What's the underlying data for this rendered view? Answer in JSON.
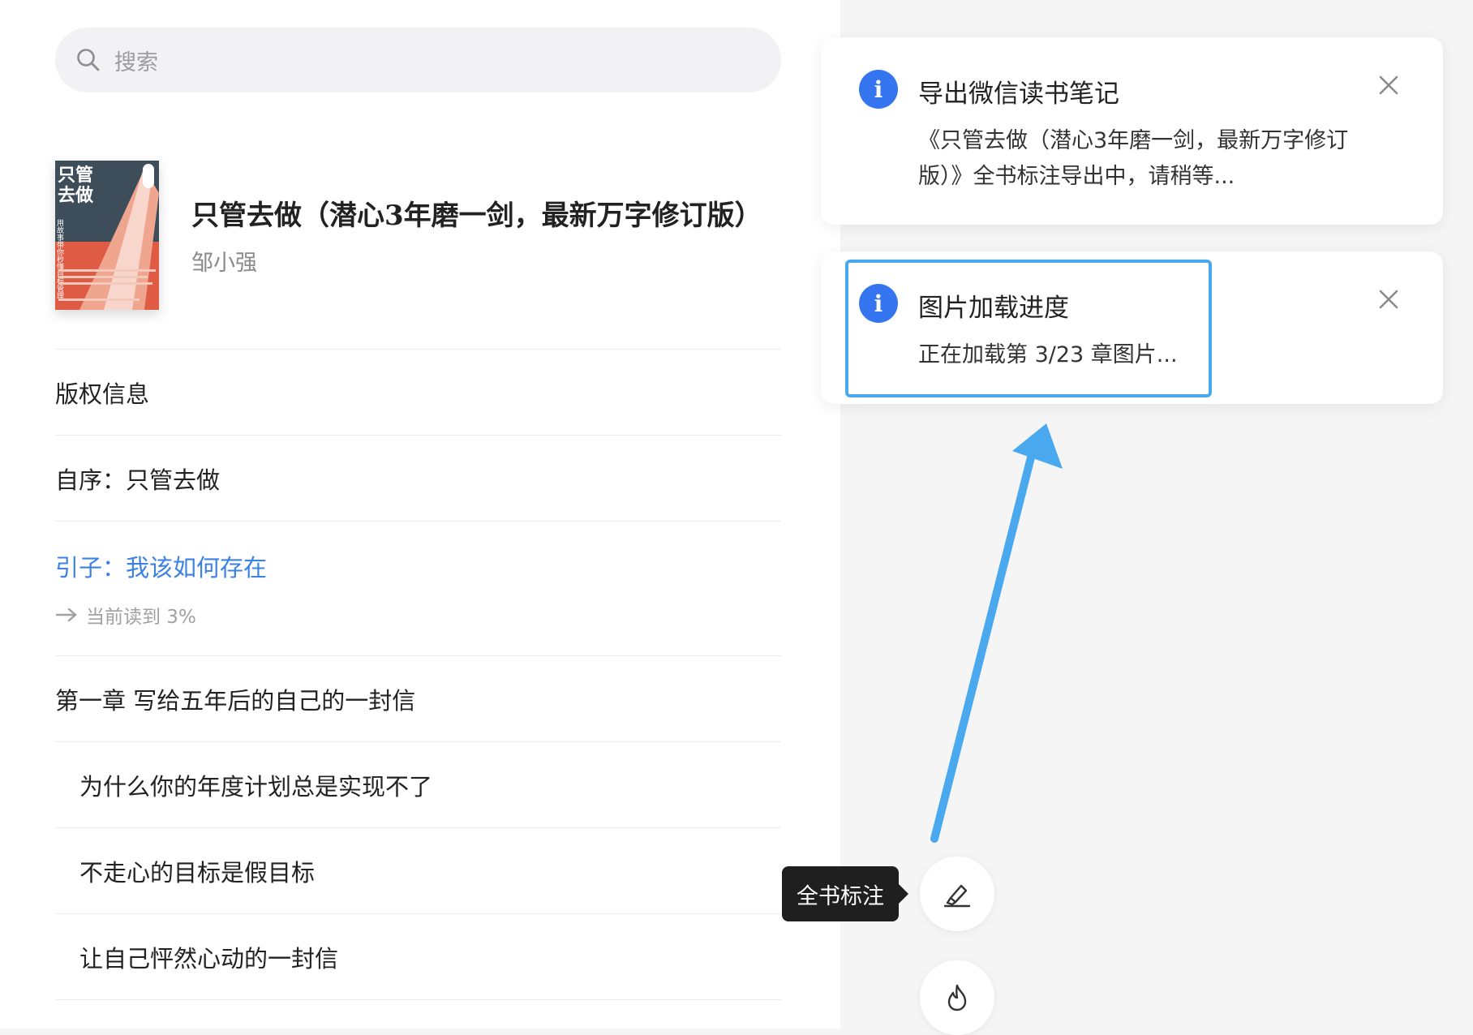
{
  "search": {
    "placeholder": "搜索"
  },
  "book": {
    "title": "只管去做（潜心3年磨一剑，最新万字修订版）",
    "author": "邹小强",
    "cover": {
      "title_line1": "只管",
      "title_line2": "去做",
      "side_text": "用故事带你秒懂目标管理",
      "colors": {
        "top": "#3d4d5a",
        "road": "#e05b44"
      }
    }
  },
  "toc": {
    "items": [
      {
        "label": "版权信息",
        "level": 0
      },
      {
        "label": "自序：只管去做",
        "level": 0
      }
    ],
    "current": {
      "label": "引子：我该如何存在",
      "progress": "当前读到 3%"
    },
    "items_after": [
      {
        "label": "第一章 写给五年后的自己的一封信",
        "level": 0
      },
      {
        "label": "为什么你的年度计划总是实现不了",
        "level": 1
      },
      {
        "label": "不走心的目标是假目标",
        "level": 1
      },
      {
        "label": "让自己怦然心动的一封信",
        "level": 1
      }
    ]
  },
  "toasts": [
    {
      "title": "导出微信读书笔记",
      "message": "《只管去做（潜心3年磨一剑，最新万字修订版）》全书标注导出中，请稍等..."
    },
    {
      "title": "图片加载进度",
      "message": "正在加载第 3/23 章图片..."
    }
  ],
  "tooltip": {
    "label": "全书标注"
  },
  "colors": {
    "accent": "#3b82e4",
    "info": "#3575f0",
    "annotation": "#4aa9ee"
  }
}
